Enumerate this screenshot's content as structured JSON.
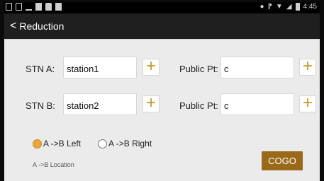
{
  "status_bar": {
    "time": "4:45",
    "icons": [
      "usb-icon",
      "image-icon",
      "upload-icon",
      "square-icon",
      "lock-icon",
      "shopping-bag-icon",
      "location-icon",
      "bluetooth-icon",
      "wifi-icon",
      "signal-icon",
      "battery-icon"
    ]
  },
  "header": {
    "back_glyph": "<",
    "title": "Reduction"
  },
  "form": {
    "stn_a_label": "STN A:",
    "stn_a_value": "station1",
    "public_pt_a_label": "Public Pt:",
    "public_pt_a_value": "c",
    "stn_b_label": "STN B:",
    "stn_b_value": "station2",
    "public_pt_b_label": "Public Pt:",
    "public_pt_b_value": "c",
    "plus_glyph": "+"
  },
  "options": {
    "left_label": "A ->B Left",
    "right_label": "A ->B Right",
    "selected": "left"
  },
  "footer": {
    "location_label": "A ->B Location",
    "cogo_label": "COGO"
  },
  "colors": {
    "accent": "#e9a73a",
    "button": "#9a6a1a",
    "header": "#1f1f1f",
    "content_bg": "#ebebeb"
  }
}
